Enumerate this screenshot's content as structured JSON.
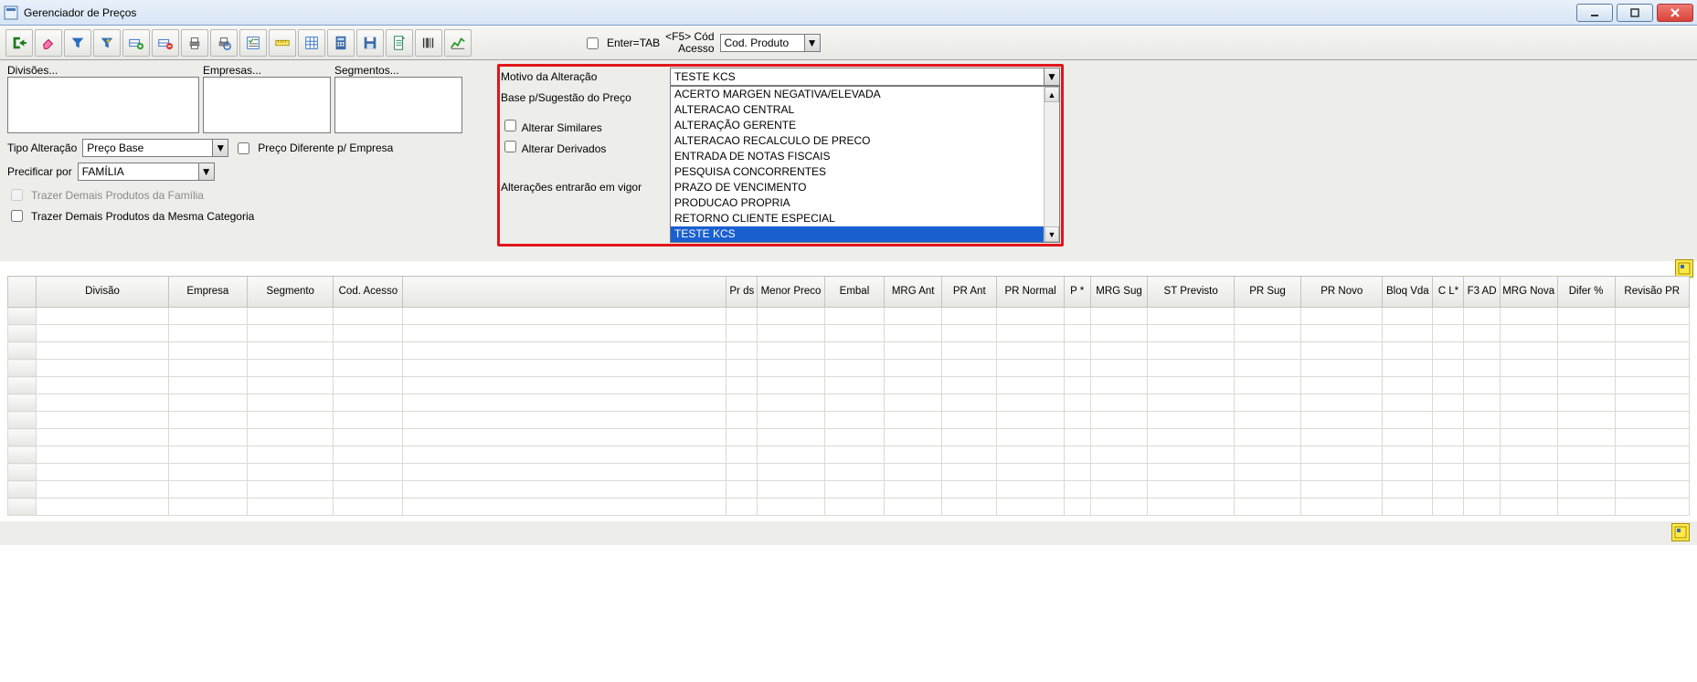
{
  "window": {
    "title": "Gerenciador de Preços"
  },
  "toolbar": {
    "enter_tab": "Enter=TAB",
    "f5_cod_acesso_line1": "<F5> Cód",
    "f5_cod_acesso_line2": "Acesso",
    "cod_produto_selected": "Cod. Produto"
  },
  "filters": {
    "divisoes_btn": "Divisões...",
    "empresas_btn": "Empresas...",
    "segmentos_btn": "Segmentos..."
  },
  "form": {
    "tipo_alteracao_label": "Tipo Alteração",
    "tipo_alteracao_value": "Preço Base",
    "preco_diferente_label": "Preço Diferente p/ Empresa",
    "precificar_label": "Precificar por",
    "precificar_value": "FAMÍLIA",
    "trazer_familia": "Trazer Demais Produtos da Família",
    "trazer_categoria": "Trazer Demais Produtos da Mesma Categoria"
  },
  "motivo": {
    "label": "Motivo da Alteração",
    "selected": "TESTE KCS",
    "base_label": "Base p/Sugestão do Preço",
    "alterar_similares": "Alterar Similares",
    "alterar_derivados": "Alterar Derivados",
    "vigor_label": "Alterações entrarão em vigor",
    "options": [
      "ACERTO MARGEN NEGATIVA/ELEVADA",
      "ALTERACAO CENTRAL",
      "ALTERAÇÃO GERENTE",
      "ALTERACAO RECALCULO DE PRECO",
      "ENTRADA DE NOTAS FISCAIS",
      "PESQUISA CONCORRENTES",
      "PRAZO DE VENCIMENTO",
      "PRODUCAO PROPRIA",
      "RETORNO CLIENTE ESPECIAL",
      "TESTE KCS"
    ]
  },
  "grid": {
    "columns": [
      "Divisão",
      "Empresa",
      "Segmento",
      "Cod. Acesso",
      "",
      "Pr ds",
      "Menor Preco",
      "Embal",
      "MRG Ant",
      "PR Ant",
      "PR Normal",
      "P *",
      "MRG Sug",
      "ST Previsto",
      "PR Sug",
      "PR Novo",
      "Bloq Vda",
      "C L*",
      "F3 AD",
      "MRG Nova",
      "Difer %",
      "Revisão PR"
    ],
    "row_count": 12
  }
}
